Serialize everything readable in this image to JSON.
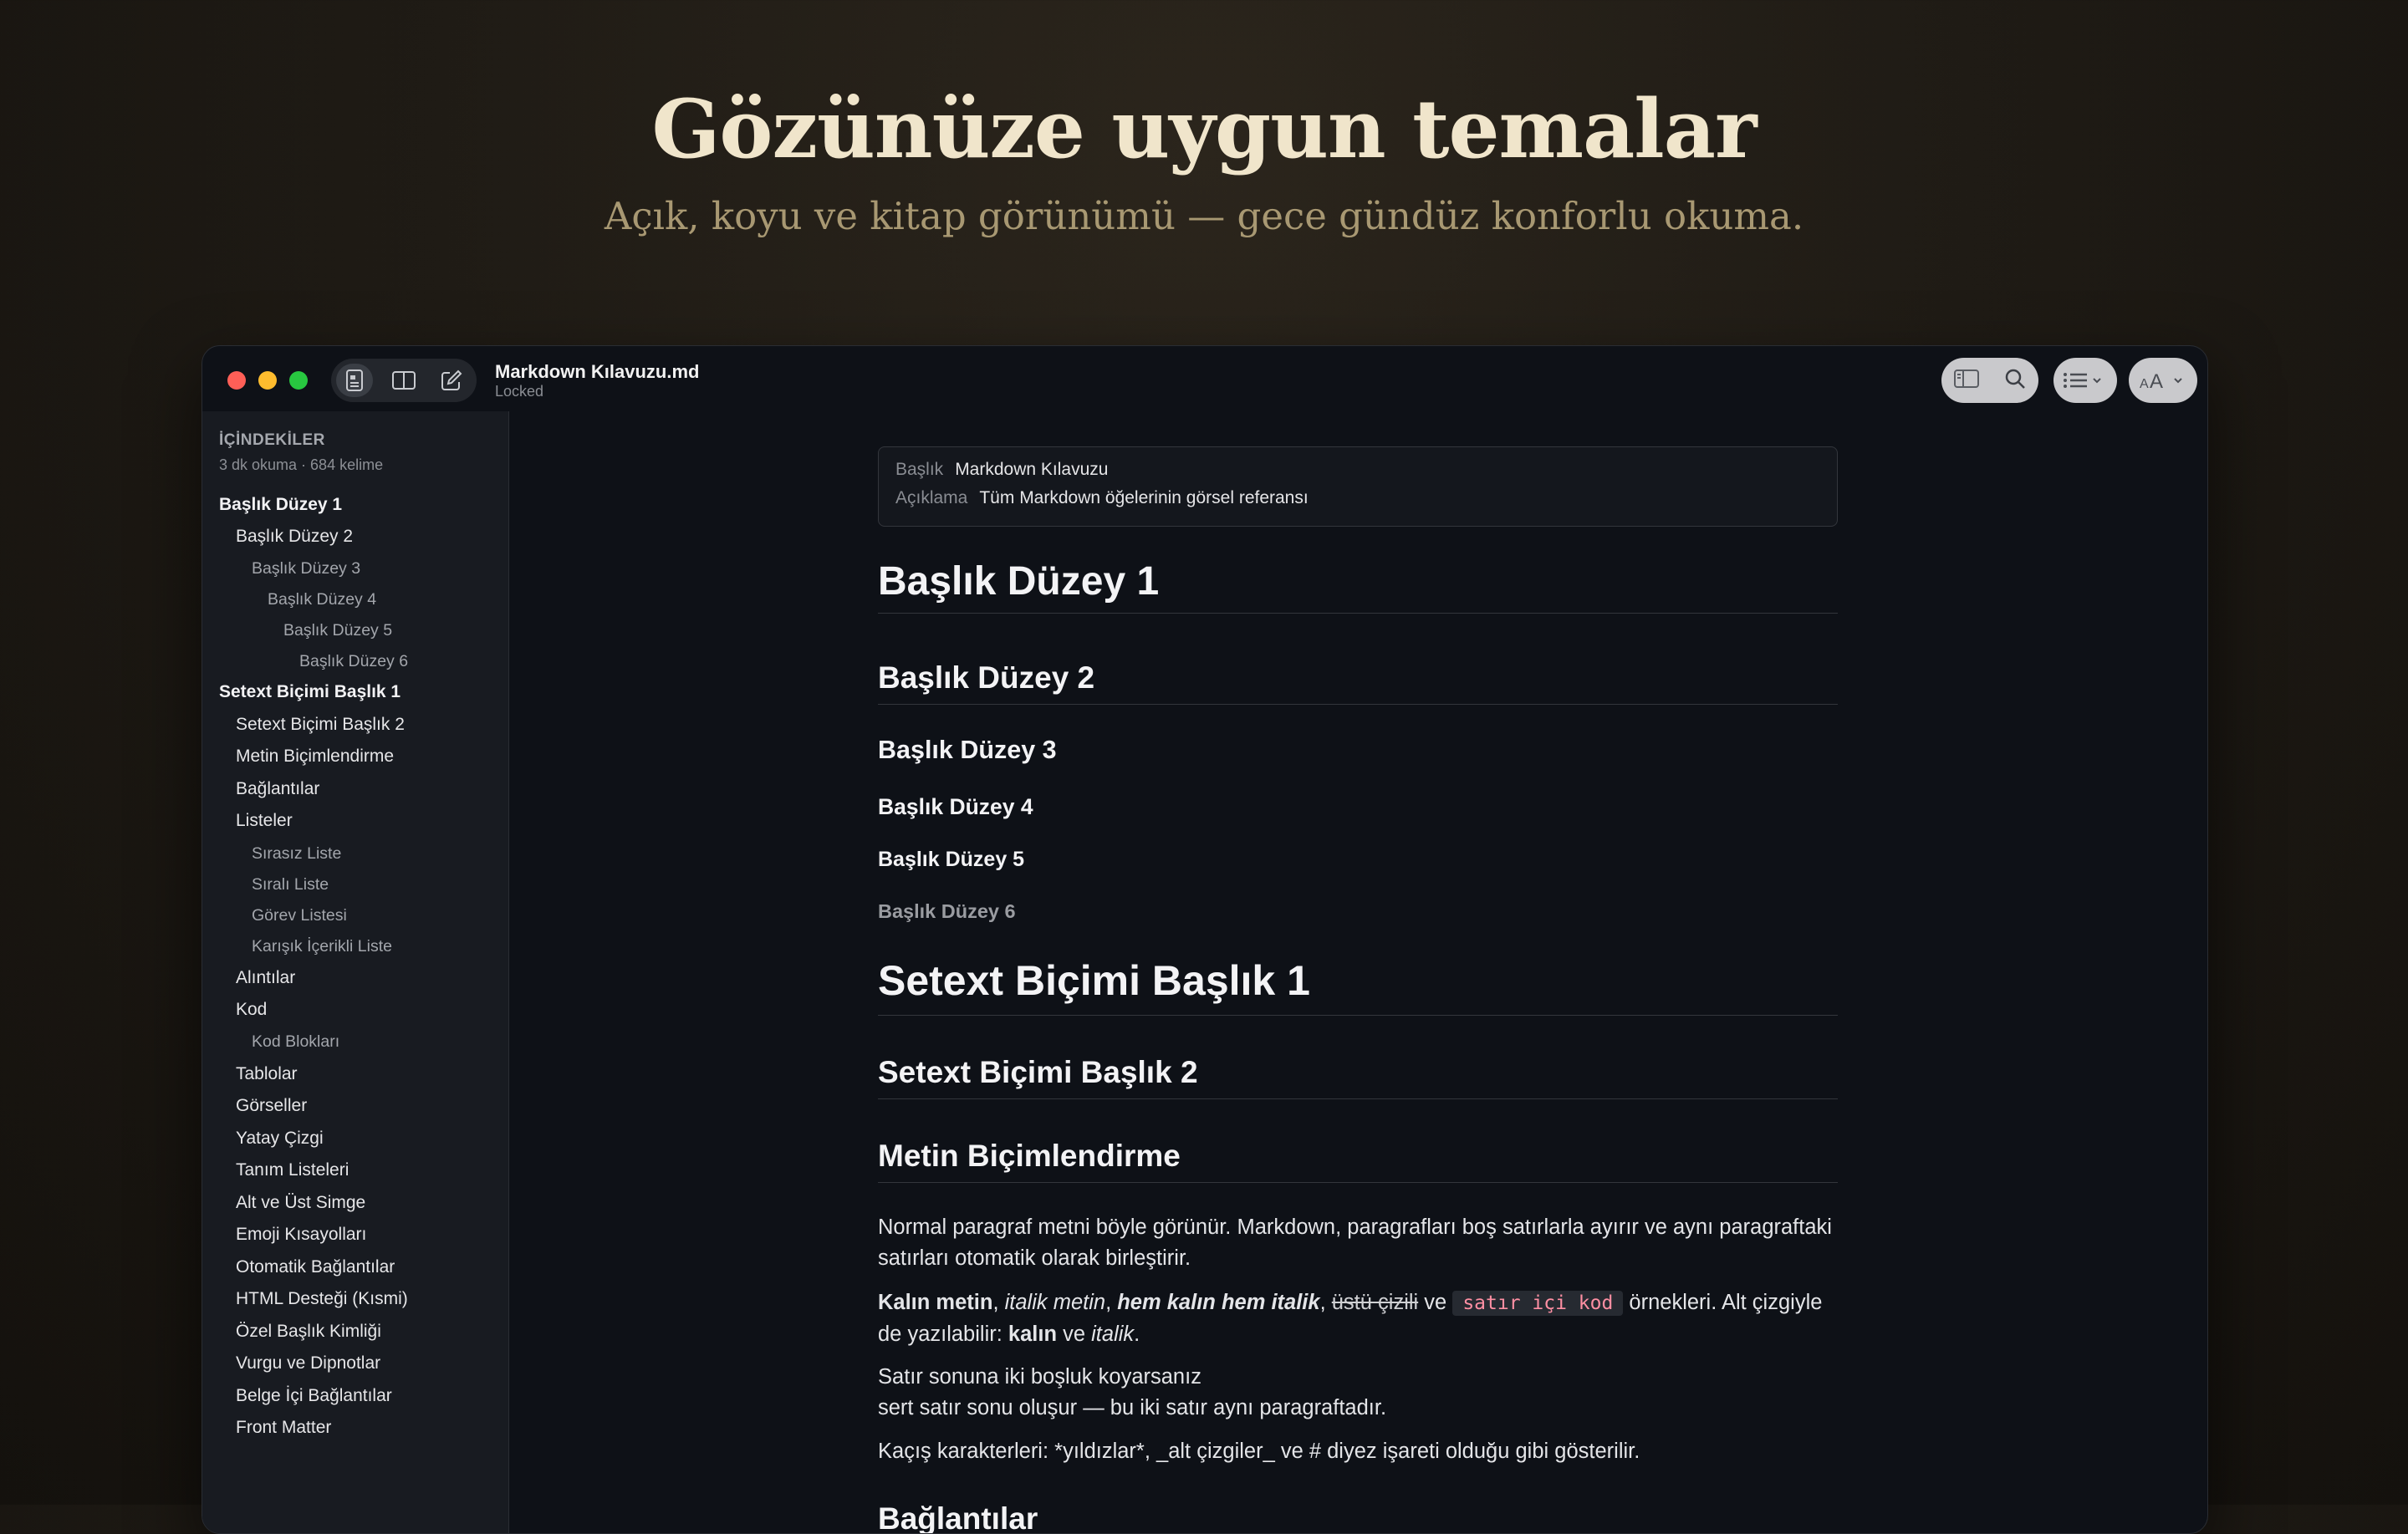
{
  "hero": {
    "title": "Gözünüze uygun temalar",
    "subtitle": "Açık, koyu ve kitap görünümü — gece gündüz konforlu okuma."
  },
  "window": {
    "title": "Markdown Kılavuzu.md",
    "status": "Locked"
  },
  "toc": {
    "heading": "İÇİNDEKİLER",
    "meta": "3 dk okuma · 684 kelime",
    "items": [
      {
        "label": "Başlık Düzey 1"
      },
      {
        "label": "Başlık Düzey 2"
      },
      {
        "label": "Başlık Düzey 3"
      },
      {
        "label": "Başlık Düzey 4"
      },
      {
        "label": "Başlık Düzey 5"
      },
      {
        "label": "Başlık Düzey 6"
      },
      {
        "label": "Setext Biçimi Başlık 1"
      },
      {
        "label": "Setext Biçimi Başlık 2"
      },
      {
        "label": "Metin Biçimlendirme"
      },
      {
        "label": "Bağlantılar"
      },
      {
        "label": "Listeler"
      },
      {
        "label": "Sırasız Liste"
      },
      {
        "label": "Sıralı Liste"
      },
      {
        "label": "Görev Listesi"
      },
      {
        "label": "Karışık İçerikli Liste"
      },
      {
        "label": "Alıntılar"
      },
      {
        "label": "Kod"
      },
      {
        "label": "Kod Blokları"
      },
      {
        "label": "Tablolar"
      },
      {
        "label": "Görseller"
      },
      {
        "label": "Yatay Çizgi"
      },
      {
        "label": "Tanım Listeleri"
      },
      {
        "label": "Alt ve Üst Simge"
      },
      {
        "label": "Emoji Kısayolları"
      },
      {
        "label": "Otomatik Bağlantılar"
      },
      {
        "label": "HTML Desteği (Kısmi)"
      },
      {
        "label": "Özel Başlık Kimliği"
      },
      {
        "label": "Vurgu ve Dipnotlar"
      },
      {
        "label": "Belge İçi Bağlantılar"
      },
      {
        "label": "Front Matter"
      }
    ]
  },
  "frontmatter": {
    "title_key": "Başlık",
    "title_value": "Markdown Kılavuzu",
    "desc_key": "Açıklama",
    "desc_value": "Tüm Markdown öğelerinin görsel referansı"
  },
  "doc": {
    "h1": "Başlık Düzey 1",
    "h2": "Başlık Düzey 2",
    "h3": "Başlık Düzey 3",
    "h4": "Başlık Düzey 4",
    "h5": "Başlık Düzey 5",
    "h6": "Başlık Düzey 6",
    "setext1": "Setext Biçimi Başlık 1",
    "setext2": "Setext Biçimi Başlık 2",
    "format_heading": "Metin Biçimlendirme",
    "para1": "Normal paragraf metni böyle görünür. Markdown, paragrafları boş satırlarla ayırır ve aynı paragraftaki satırları otomatik olarak birleştirir.",
    "p2": {
      "bold": "Kalın metin",
      "sep1": ", ",
      "italic": "italik metin",
      "sep2": ", ",
      "bolditalic": "hem kalın hem italik",
      "sep3": ", ",
      "strike": "üstü çizili",
      "and1": " ve ",
      "code": "satır içi kod",
      "rest": " örnekleri. Alt çizgiyle de yazılabilir: ",
      "bold2": "kalın",
      "and2": " ve ",
      "italic2": "italik",
      "end": "."
    },
    "p3_line1": "Satır sonuna iki boşluk koyarsanız",
    "p3_line2": "sert satır sonu oluşur — bu iki satır aynı paragraftadır.",
    "p4": "Kaçış karakterleri: *yıldızlar*, _alt çizgiler_ ve # diyez işareti olduğu gibi gösterilir.",
    "next_heading": "Bağlantılar"
  }
}
